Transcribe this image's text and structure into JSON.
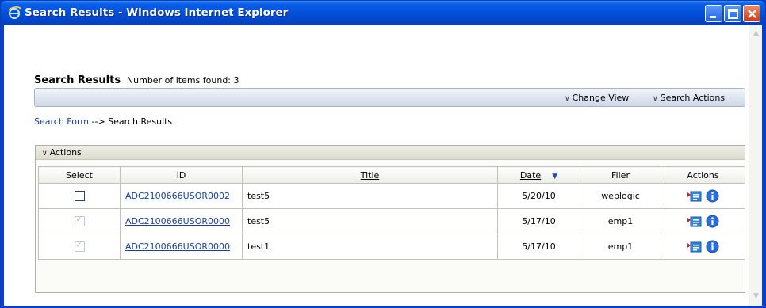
{
  "window": {
    "title": "Search Results - Windows Internet Explorer"
  },
  "page": {
    "heading": "Search Results",
    "item_count_text": "Number of items found: 3"
  },
  "toolbar": {
    "change_view_label": "Change View",
    "search_actions_label": "Search Actions"
  },
  "breadcrumb": {
    "link_label": "Search Form",
    "separator": "-->",
    "current": "Search Results"
  },
  "actions_panel": {
    "label": "Actions"
  },
  "table": {
    "columns": [
      "Select",
      "ID",
      "Title",
      "Date",
      "Filer",
      "Actions"
    ],
    "sorted_column": "Date",
    "sort_direction": "descending",
    "rows": [
      {
        "selected": false,
        "disabled": false,
        "id": "ADC2100666USOR0002",
        "title": "test5",
        "date": "5/20/10",
        "filer": "weblogic",
        "actions": [
          "document-icon",
          "info-icon"
        ]
      },
      {
        "selected": true,
        "disabled": true,
        "id": "ADC2100666USOR0000",
        "title": "test5",
        "date": "5/17/10",
        "filer": "emp1",
        "actions": [
          "document-icon",
          "info-icon"
        ]
      },
      {
        "selected": true,
        "disabled": true,
        "id": "ADC2100666USOR0000",
        "title": "test1",
        "date": "5/17/10",
        "filer": "emp1",
        "actions": [
          "document-icon",
          "info-icon"
        ]
      }
    ]
  },
  "colors": {
    "titlebar": "#0451dd",
    "link": "#1b3fa3",
    "close_button": "#c8381a"
  }
}
